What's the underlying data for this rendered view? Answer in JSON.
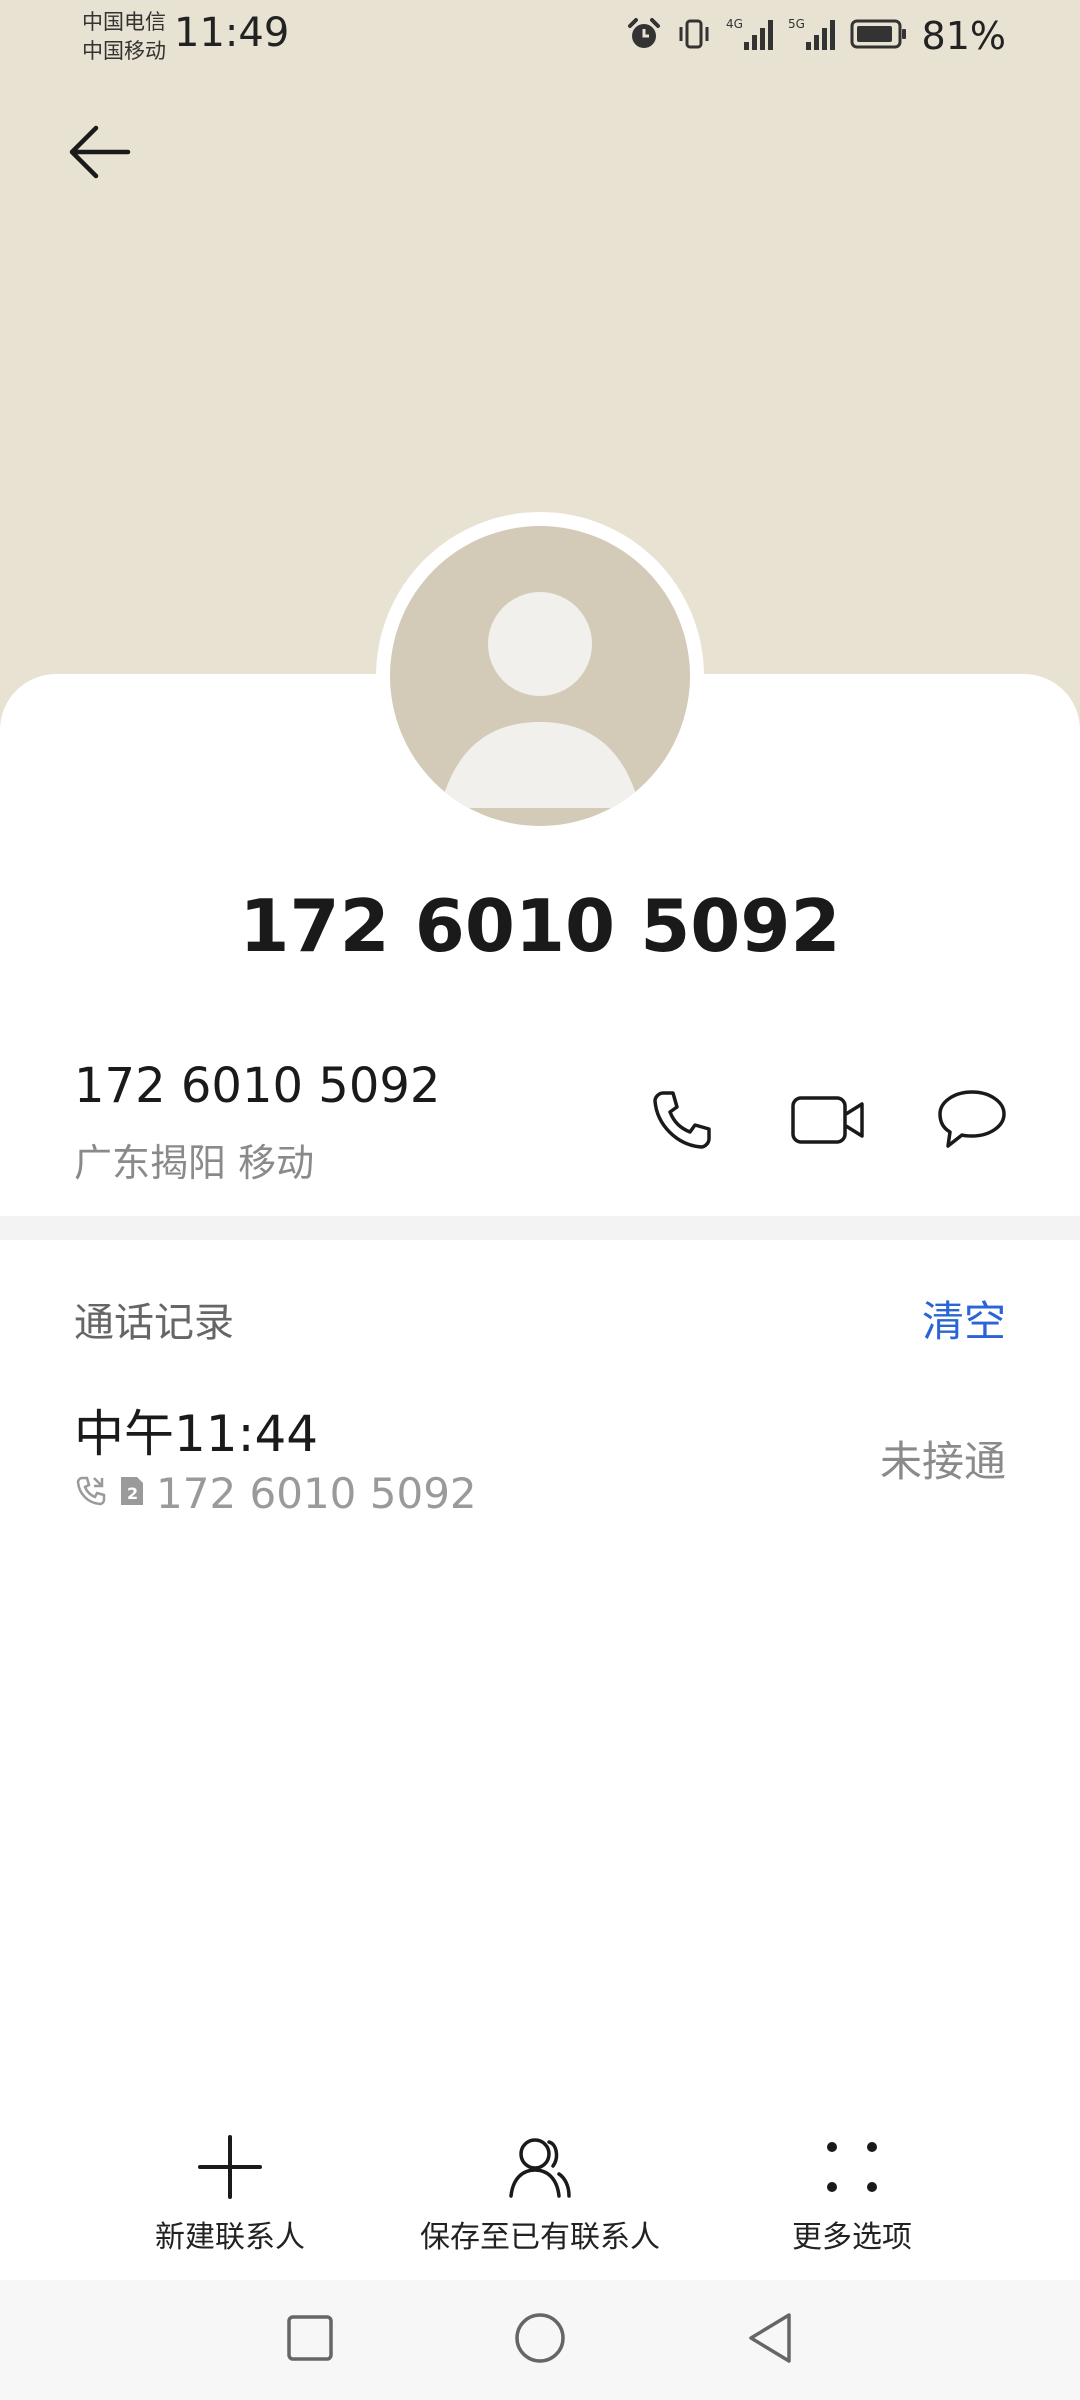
{
  "status_bar": {
    "carrier_1": "中国电信",
    "carrier_2": "中国移动",
    "time": "11:49",
    "battery_percent": "81%",
    "network_1": "4G",
    "network_2": "5G",
    "icons": [
      "alarm-icon",
      "vibrate-icon",
      "signal-4g-icon",
      "signal-5g-icon",
      "battery-icon"
    ]
  },
  "header": {
    "back_icon": "back-arrow-icon"
  },
  "contact": {
    "display_name": "172 6010 5092",
    "number": "172 6010 5092",
    "location": "广东揭阳 移动",
    "actions": [
      "phone-icon",
      "video-call-icon",
      "message-icon"
    ]
  },
  "call_history": {
    "title": "通话记录",
    "clear_label": "清空",
    "records": [
      {
        "time": "中午11:44",
        "number": "172 6010 5092",
        "sim": "2",
        "status": "未接通"
      }
    ]
  },
  "bottom_actions": {
    "new_contact": "新建联系人",
    "save_existing": "保存至已有联系人",
    "more_options": "更多选项"
  },
  "colors": {
    "header_bg": "#e8e2d2",
    "avatar_bg": "#d3cbb8",
    "accent": "#2a64d6"
  }
}
